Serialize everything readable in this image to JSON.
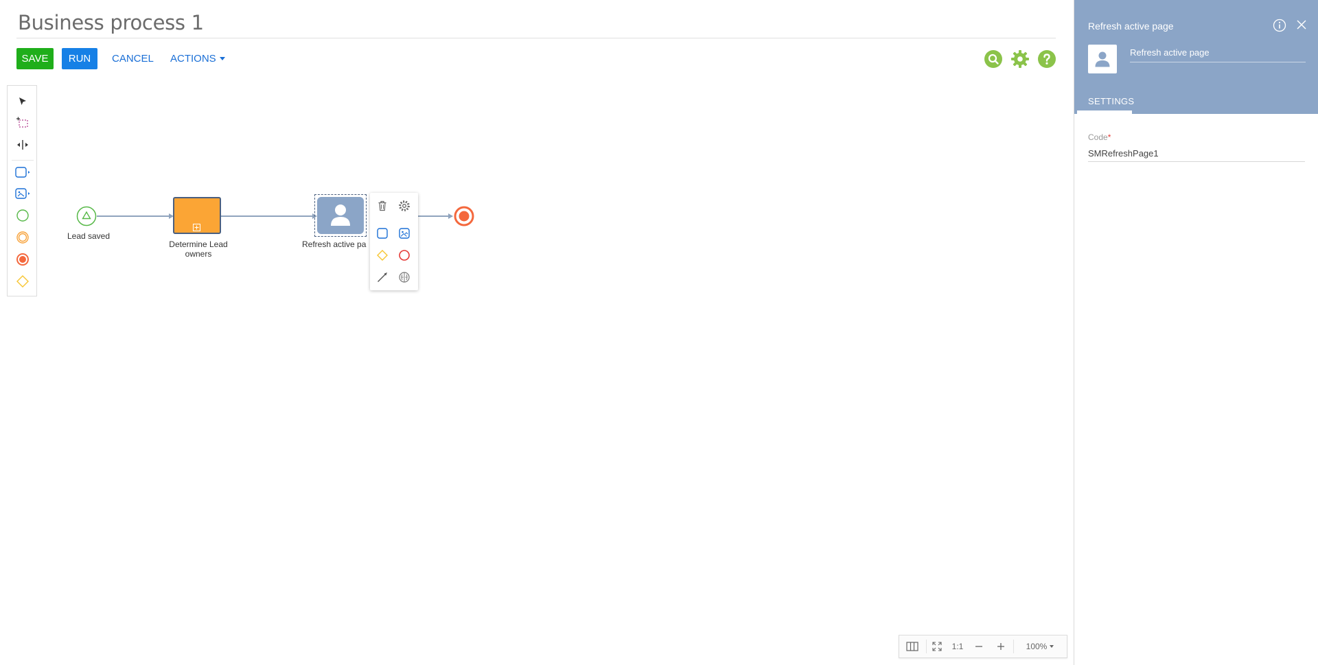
{
  "header": {
    "title": "Business process 1",
    "save_label": "SAVE",
    "run_label": "RUN",
    "cancel_label": "CANCEL",
    "actions_label": "ACTIONS"
  },
  "toolbar_icons": [
    "search-icon",
    "gear-icon",
    "help-icon"
  ],
  "palette": {
    "items": [
      "pointer-tool",
      "lasso-select-tool",
      "space-tool",
      "task-element",
      "sub-process-element",
      "start-event",
      "intermediate-event",
      "end-event",
      "gateway"
    ]
  },
  "diagram": {
    "nodes": [
      {
        "id": "start",
        "label": "Lead saved"
      },
      {
        "id": "subprocess",
        "label": "Determine Lead owners"
      },
      {
        "id": "user-task",
        "label": "Refresh active pa"
      },
      {
        "id": "end",
        "label": ""
      }
    ]
  },
  "context_menu": {
    "items": [
      "delete-icon",
      "settings-icon",
      "task-icon",
      "subprocess-icon",
      "gateway-icon",
      "end-event-icon",
      "connector-icon",
      "ai-icon"
    ]
  },
  "zoom": {
    "fit_label": "1:1",
    "level_label": "100%"
  },
  "panel": {
    "title": "Refresh active page",
    "element_name": "Refresh active page",
    "tab_label": "SETTINGS",
    "code_label": "Code",
    "code_required_mark": "*",
    "code_value": "SMRefreshPage1"
  },
  "colors": {
    "save": "#1fae1a",
    "run": "#1680e6",
    "link": "#1a6fd6",
    "panel_header": "#8ba5c7",
    "subprocess_fill": "#fba535",
    "end_event": "#f4683d",
    "start_event": "#56b847",
    "icon_green": "#8bc34a"
  }
}
